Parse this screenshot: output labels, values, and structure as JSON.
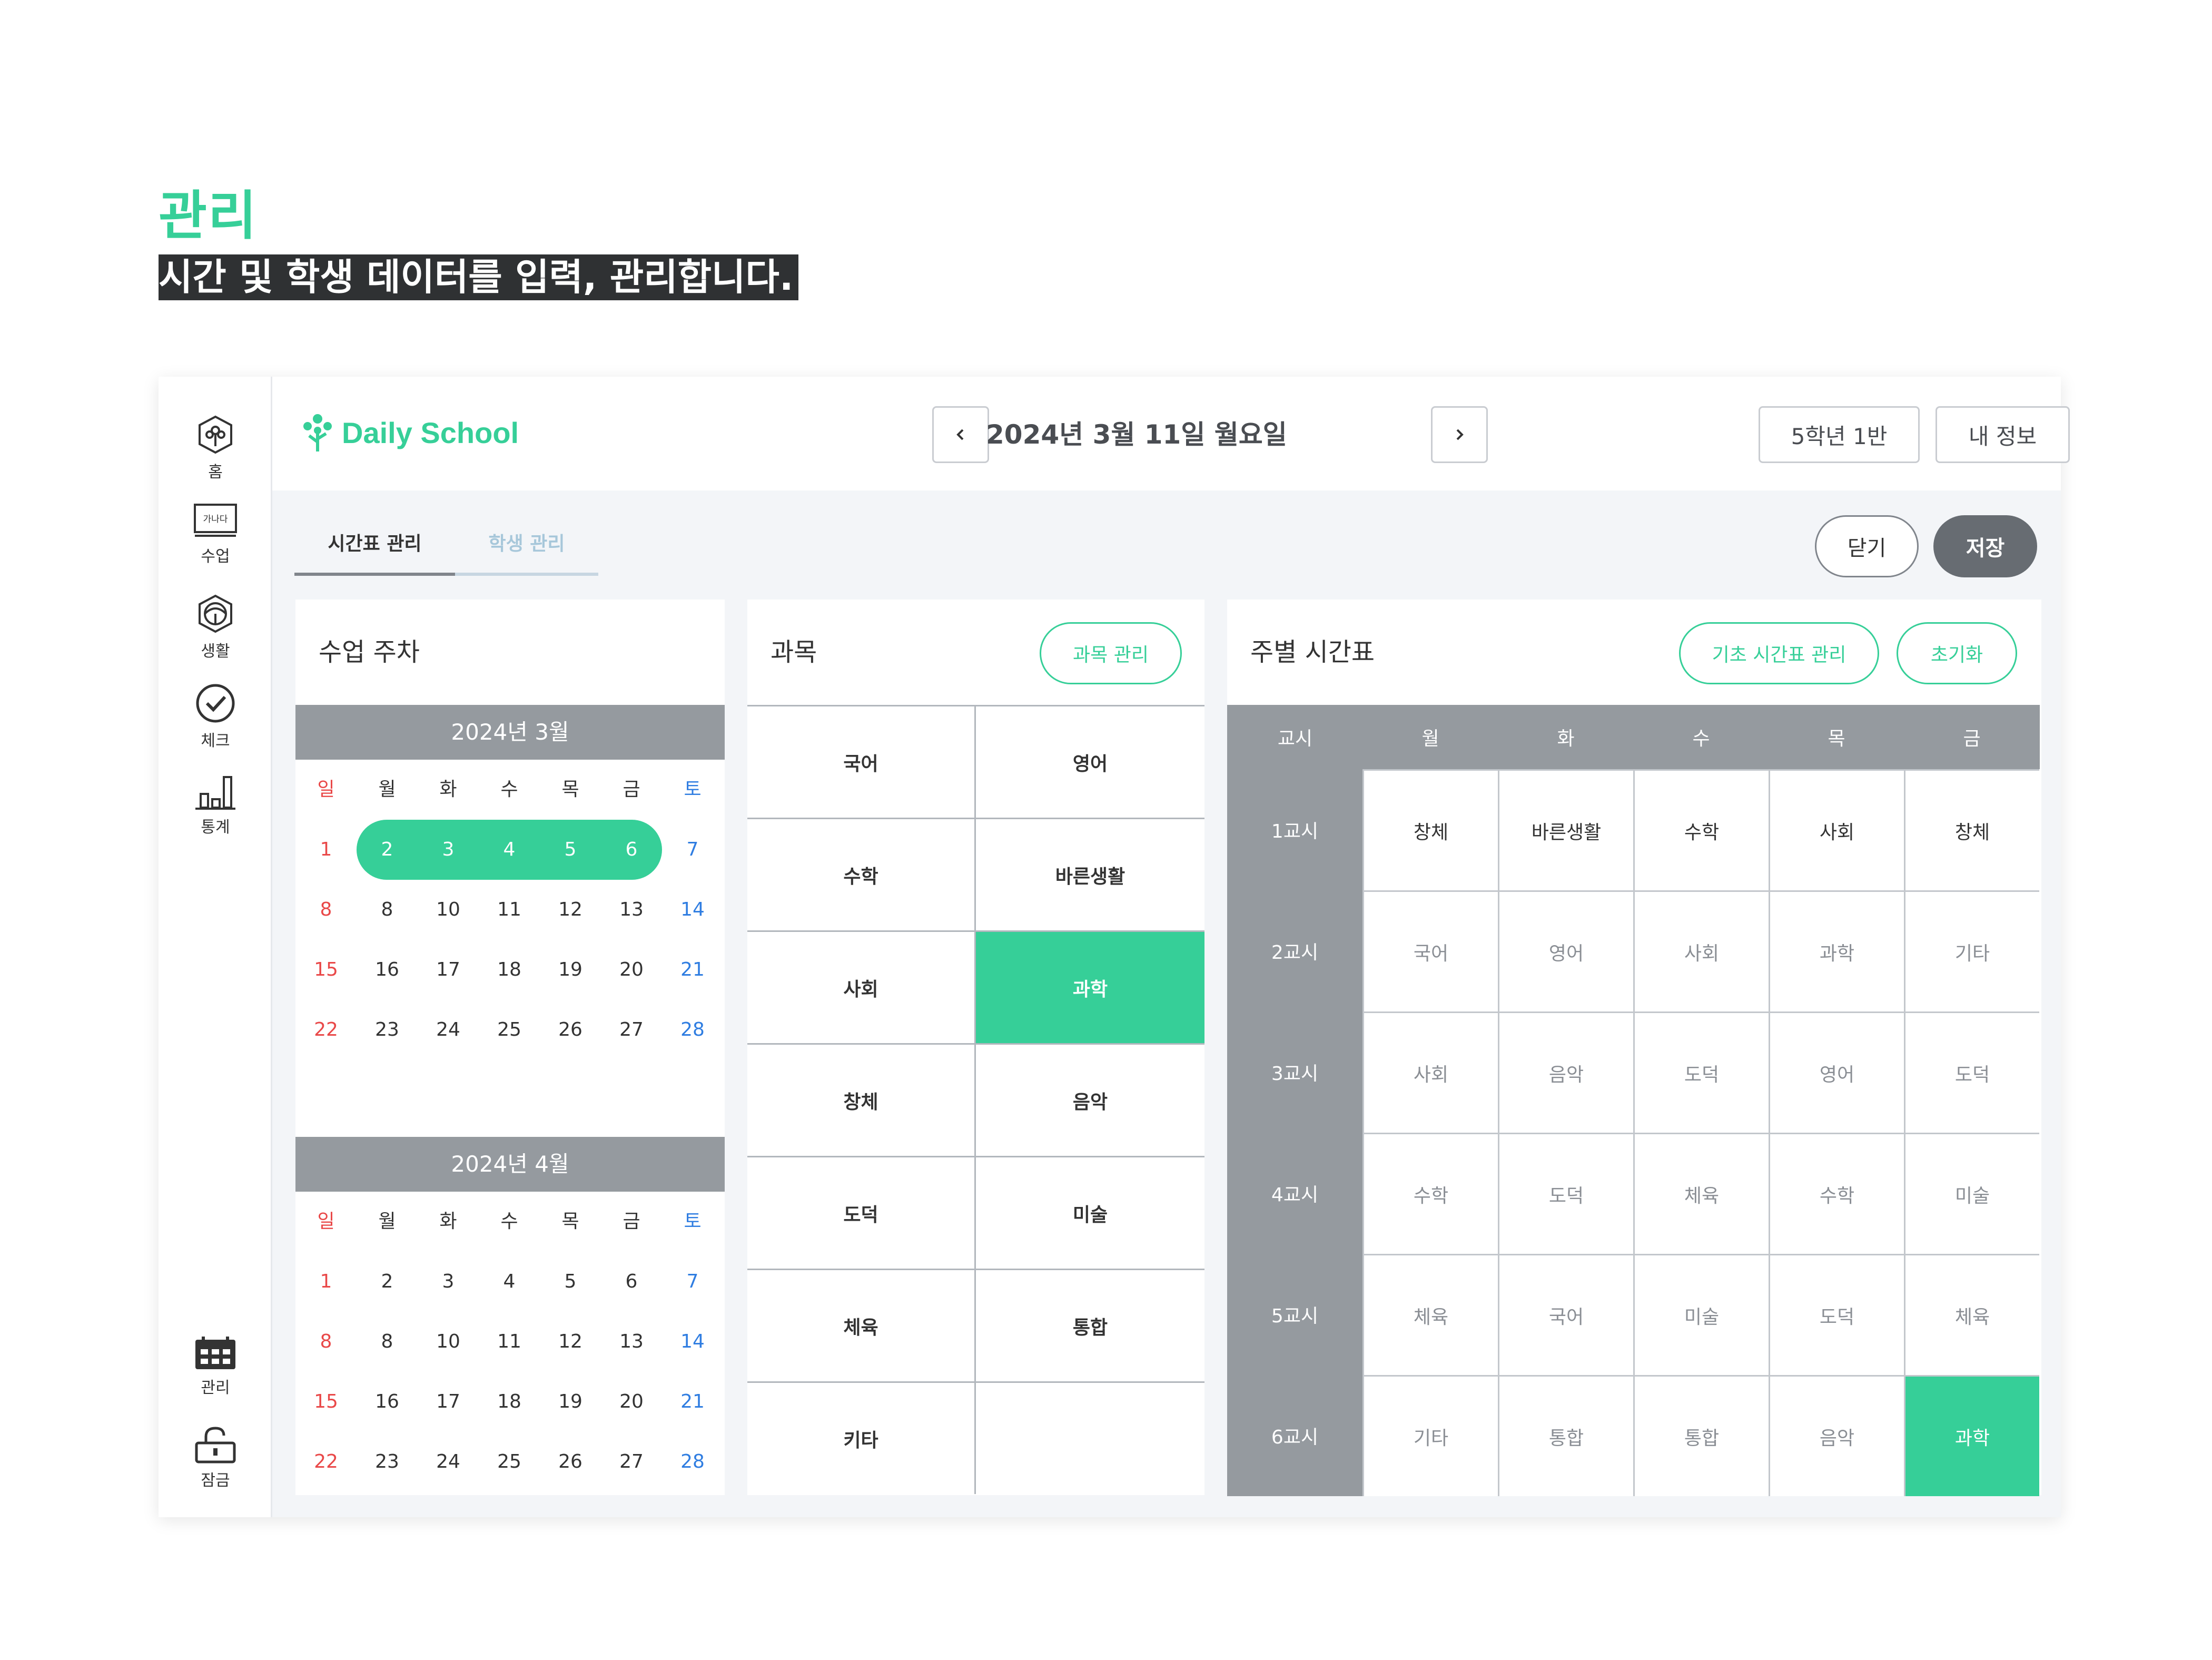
{
  "hero": {
    "title": "관리",
    "subtitle": "시간 및 학생 데이터를 입력, 관리합니다."
  },
  "rail": {
    "items": [
      {
        "label": "홈",
        "icon": "home-tree-icon"
      },
      {
        "label": "수업",
        "icon": "lesson-board-icon",
        "badge": "가나다"
      },
      {
        "label": "생활",
        "icon": "life-icon"
      },
      {
        "label": "체크",
        "icon": "check-circle-icon"
      },
      {
        "label": "통계",
        "icon": "bar-chart-icon"
      },
      {
        "label": "관리",
        "icon": "calendar-manage-icon",
        "active": true
      },
      {
        "label": "잠금",
        "icon": "lock-icon"
      }
    ]
  },
  "header": {
    "logo": "Daily School",
    "date": "2024년 3월 11일 월요일",
    "class_button": "5학년 1반",
    "profile_button": "내 정보"
  },
  "tabs": [
    {
      "label": "시간표 관리",
      "active": true
    },
    {
      "label": "학생 관리",
      "active": false
    }
  ],
  "actions": {
    "close": "닫기",
    "save": "저장"
  },
  "week_panel": {
    "title": "수업 주차",
    "weekdays": [
      "일",
      "월",
      "화",
      "수",
      "목",
      "금",
      "토"
    ],
    "months": [
      {
        "title": "2024년 3월",
        "weeks": [
          [
            "1",
            "2",
            "3",
            "4",
            "5",
            "6",
            "7"
          ],
          [
            "8",
            "8",
            "10",
            "11",
            "12",
            "13",
            "14"
          ],
          [
            "15",
            "16",
            "17",
            "18",
            "19",
            "20",
            "21"
          ],
          [
            "22",
            "23",
            "24",
            "25",
            "26",
            "27",
            "28"
          ]
        ],
        "selected_week": 0
      },
      {
        "title": "2024년 4월",
        "weeks": [
          [
            "1",
            "2",
            "3",
            "4",
            "5",
            "6",
            "7"
          ],
          [
            "8",
            "8",
            "10",
            "11",
            "12",
            "13",
            "14"
          ],
          [
            "15",
            "16",
            "17",
            "18",
            "19",
            "20",
            "21"
          ],
          [
            "22",
            "23",
            "24",
            "25",
            "26",
            "27",
            "28"
          ]
        ]
      }
    ]
  },
  "subject_panel": {
    "title": "과목",
    "manage_button": "과목 관리",
    "subjects": [
      [
        "국어",
        "영어"
      ],
      [
        "수학",
        "바른생활"
      ],
      [
        "사회",
        "과학"
      ],
      [
        "창체",
        "음악"
      ],
      [
        "도덕",
        "미술"
      ],
      [
        "체육",
        "통합"
      ],
      [
        "키타",
        ""
      ]
    ],
    "highlighted": "과학"
  },
  "timetable_panel": {
    "title": "주별 시간표",
    "base_button": "기초 시간표 관리",
    "reset_button": "초기화",
    "header": [
      "교시",
      "월",
      "화",
      "수",
      "목",
      "금"
    ],
    "rows": [
      {
        "period": "1교시",
        "cells": [
          "창체",
          "바른생활",
          "수학",
          "사회",
          "창체"
        ]
      },
      {
        "period": "2교시",
        "cells": [
          "국어",
          "영어",
          "사회",
          "과학",
          "기타"
        ]
      },
      {
        "period": "3교시",
        "cells": [
          "사회",
          "음악",
          "도덕",
          "영어",
          "도덕"
        ]
      },
      {
        "period": "4교시",
        "cells": [
          "수학",
          "도덕",
          "체육",
          "수학",
          "미술"
        ]
      },
      {
        "period": "5교시",
        "cells": [
          "체육",
          "국어",
          "미술",
          "도덕",
          "체육"
        ]
      },
      {
        "period": "6교시",
        "cells": [
          "기타",
          "통합",
          "통합",
          "음악",
          "과학"
        ]
      }
    ]
  },
  "colors": {
    "accent": "#36cf98",
    "header_gray": "#959a9f",
    "sunday": "#e94848",
    "saturday": "#2f7de1"
  }
}
